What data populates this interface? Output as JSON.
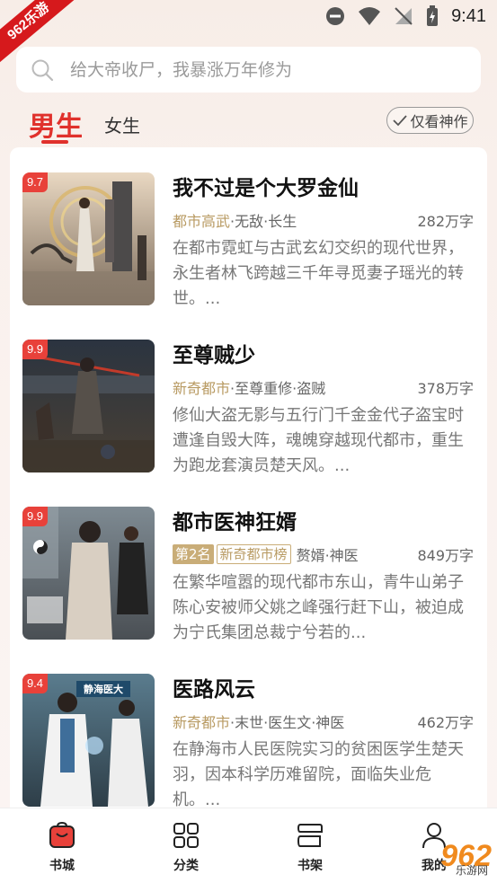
{
  "status_bar": {
    "ribbon": "962乐游",
    "time": "9:41"
  },
  "search": {
    "placeholder": "给大帝收尸，我暴涨万年修为"
  },
  "tabs": {
    "male": "男生",
    "female": "女生",
    "filter_label": "仅看神作"
  },
  "books": [
    {
      "score": "9.7",
      "title": "我不过是个大罗金仙",
      "genre": "都市高武",
      "tags": "·无敌·长生",
      "words": "282万字",
      "description": "在都市霓虹与古武玄幻交织的现代世界，永生者林飞跨越三千年寻觅妻子瑶光的转世。..."
    },
    {
      "score": "9.9",
      "title": "至尊贼少",
      "genre": "新奇都市",
      "tags": "·至尊重修·盗贼",
      "words": "378万字",
      "description": "修仙大盗无影与五行门千金金代子盗宝时遭逢自毁大阵，魂魄穿越现代都市，重生为跑龙套演员楚天风。..."
    },
    {
      "score": "9.9",
      "title": "都市医神狂婿",
      "rank": "第2名",
      "rank_list": "新奇都市榜",
      "tags": "赘婿·神医",
      "words": "849万字",
      "description": "在繁华喧嚣的现代都市东山，青牛山弟子陈心安被师父姚之峰强行赶下山，被迫成为宁氏集团总裁宁兮若的..."
    },
    {
      "score": "9.4",
      "title": "医路风云",
      "genre": "新奇都市",
      "tags": "·末世·医生文·神医",
      "words": "462万字",
      "description": "在静海市人民医院实习的贫困医学生楚天羽，因本科学历难留院，面临失业危机。..."
    }
  ],
  "nav": {
    "bookstore": "书城",
    "category": "分类",
    "bookshelf": "书架",
    "mine": "我的"
  },
  "watermark": "962",
  "watermark_sub": "乐游网",
  "colors": {
    "accent": "#e0312c",
    "genre": "#b89a62",
    "score_bg": "#e8413a"
  }
}
